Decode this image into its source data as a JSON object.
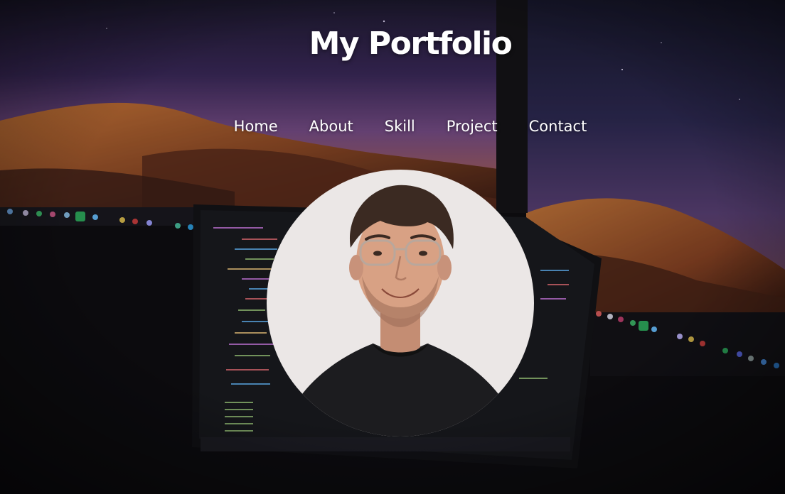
{
  "header": {
    "title": "My Portfolio"
  },
  "nav": {
    "items": [
      {
        "label": "Home"
      },
      {
        "label": "About"
      },
      {
        "label": "Skill"
      },
      {
        "label": "Project"
      },
      {
        "label": "Contact"
      }
    ]
  },
  "colors": {
    "text": "#ffffff",
    "sky_top": "#2a2142",
    "sky_mid": "#6b4a8c",
    "dune": "#b0602a",
    "background": "#0e0d10",
    "avatar_bg": "#ece9e8"
  },
  "icons": {
    "avatar": "profile-photo",
    "background": "desk-setup-photo"
  }
}
